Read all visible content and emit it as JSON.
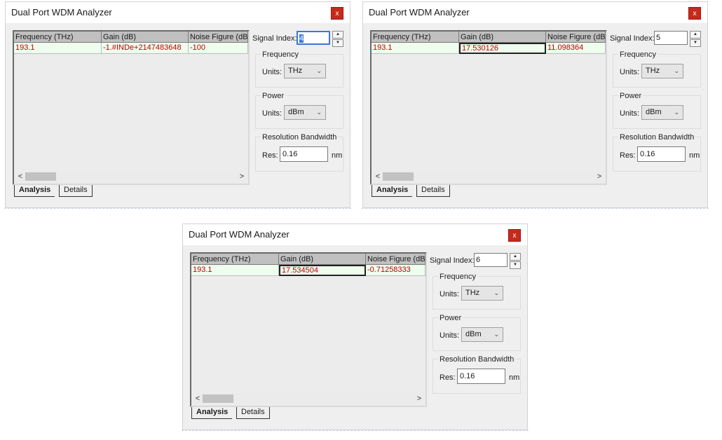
{
  "windows": [
    {
      "title": "Dual Port WDM Analyzer",
      "close_label": "x",
      "columns": [
        "Frequency (THz)",
        "Gain (dB)",
        "Noise Figure (dB)"
      ],
      "row": [
        "193.1",
        "-1.#INDe+2147483648",
        "-100"
      ],
      "signal_index_label": "Signal Index:",
      "signal_index": "4",
      "frequency_group": "Frequency",
      "frequency_units_label": "Units:",
      "frequency_units": "THz",
      "power_group": "Power",
      "power_units_label": "Units:",
      "power_units": "dBm",
      "res_group": "Resolution Bandwidth",
      "res_label": "Res:",
      "res_value": "0.16",
      "res_unit": "nm",
      "tab_analysis": "Analysis",
      "tab_details": "Details",
      "scroll_left": "<",
      "scroll_right": ">"
    },
    {
      "title": "Dual Port WDM Analyzer",
      "close_label": "x",
      "columns": [
        "Frequency (THz)",
        "Gain (dB)",
        "Noise Figure (dB)"
      ],
      "row": [
        "193.1",
        "17.530126",
        "11.098364"
      ],
      "signal_index_label": "Signal Index:",
      "signal_index": "5",
      "frequency_group": "Frequency",
      "frequency_units_label": "Units:",
      "frequency_units": "THz",
      "power_group": "Power",
      "power_units_label": "Units:",
      "power_units": "dBm",
      "res_group": "Resolution Bandwidth",
      "res_label": "Res:",
      "res_value": "0.16",
      "res_unit": "nm",
      "tab_analysis": "Analysis",
      "tab_details": "Details",
      "scroll_left": "<",
      "scroll_right": ">"
    },
    {
      "title": "Dual Port WDM Analyzer",
      "close_label": "x",
      "columns": [
        "Frequency (THz)",
        "Gain (dB)",
        "Noise Figure (dB)"
      ],
      "row": [
        "193.1",
        "17.534504",
        "-0.71258333"
      ],
      "signal_index_label": "Signal Index:",
      "signal_index": "6",
      "frequency_group": "Frequency",
      "frequency_units_label": "Units:",
      "frequency_units": "THz",
      "power_group": "Power",
      "power_units_label": "Units:",
      "power_units": "dBm",
      "res_group": "Resolution Bandwidth",
      "res_label": "Res:",
      "res_value": "0.16",
      "res_unit": "nm",
      "tab_analysis": "Analysis",
      "tab_details": "Details",
      "scroll_left": "<",
      "scroll_right": ">"
    }
  ],
  "colors": {
    "close_button": "#c42b1c",
    "cell_text": "#c00000",
    "row_background": "#eefdee",
    "focus_accent": "#3a78d8"
  }
}
